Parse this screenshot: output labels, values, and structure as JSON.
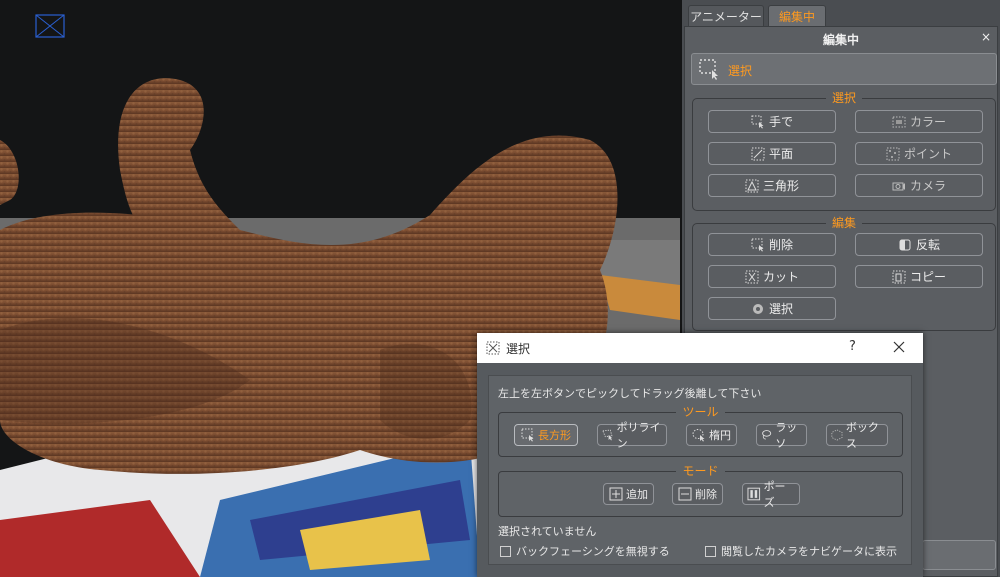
{
  "panel": {
    "tabs": [
      {
        "label": "アニメーター"
      },
      {
        "label": "編集中"
      }
    ],
    "title": "編集中",
    "close": "×",
    "mode_button": {
      "label": "選択",
      "icon": "rect-select-icon"
    },
    "select_group": {
      "title": "選択",
      "buttons": [
        {
          "label": "手で",
          "icon": "hand-select-icon"
        },
        {
          "label": "カラー",
          "icon": "color-select-icon"
        },
        {
          "label": "平面",
          "icon": "plane-select-icon"
        },
        {
          "label": "ポイント",
          "icon": "point-select-icon"
        },
        {
          "label": "三角形",
          "icon": "triangle-select-icon"
        },
        {
          "label": "カメラ",
          "icon": "camera-icon"
        }
      ]
    },
    "edit_group": {
      "title": "編集",
      "buttons": [
        {
          "label": "削除",
          "icon": "delete-icon"
        },
        {
          "label": "反転",
          "icon": "invert-icon"
        },
        {
          "label": "カット",
          "icon": "cut-icon"
        },
        {
          "label": "コピー",
          "icon": "copy-icon"
        },
        {
          "label": "選択",
          "icon": "select-all-icon"
        }
      ]
    }
  },
  "dialog": {
    "title": "選択",
    "help": "?",
    "instruction": "左上を左ボタンでピックしてドラッグ後離して下さい",
    "tool_group": {
      "title": "ツール",
      "buttons": [
        {
          "label": "長方形",
          "icon": "rectangle-icon",
          "active": true
        },
        {
          "label": "ポリライン",
          "icon": "polyline-icon"
        },
        {
          "label": "楕円",
          "icon": "ellipse-icon"
        },
        {
          "label": "ラッソ",
          "icon": "lasso-icon"
        },
        {
          "label": "ボックス",
          "icon": "box-icon"
        }
      ]
    },
    "mode_group": {
      "title": "モード",
      "buttons": [
        {
          "label": "追加",
          "icon": "add-icon"
        },
        {
          "label": "削除",
          "icon": "subtract-icon"
        },
        {
          "label": "ポーズ",
          "icon": "pause-icon"
        }
      ]
    },
    "status": "選択されていません",
    "checkboxes": [
      {
        "label": "バックフェーシングを無視する",
        "checked": false
      },
      {
        "label": "閲覧したカメラをナビゲータに表示",
        "checked": false
      }
    ]
  },
  "colors": {
    "accent": "#ff9a1f",
    "panel_bg": "#5b5e62",
    "viewport_bg": "#141516"
  }
}
